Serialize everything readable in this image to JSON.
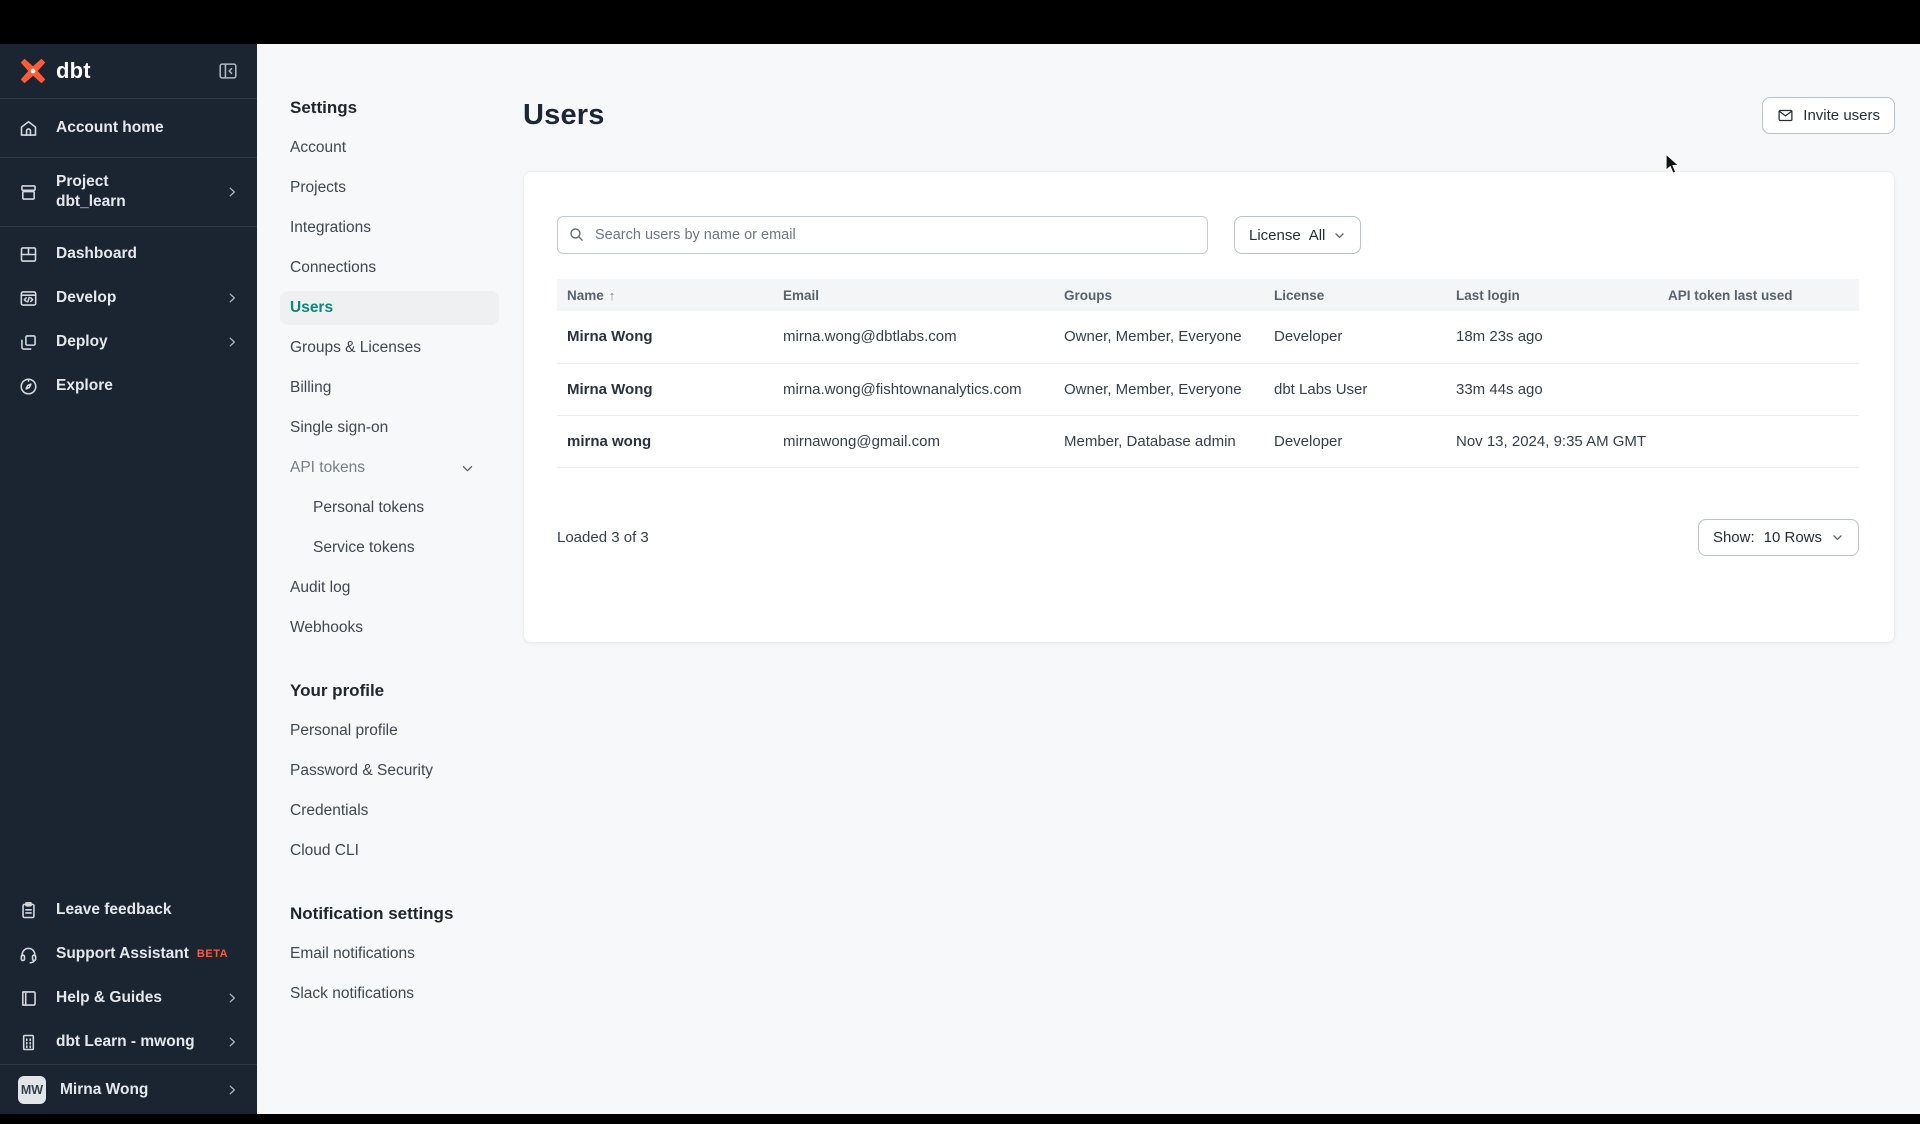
{
  "sidebar": {
    "logo_text": "dbt",
    "items": {
      "account_home": "Account home",
      "project_label": "Project",
      "project_name": "dbt_learn",
      "dashboard": "Dashboard",
      "develop": "Develop",
      "deploy": "Deploy",
      "explore": "Explore",
      "leave_feedback": "Leave feedback",
      "support_assistant": "Support Assistant",
      "support_badge": "BETA",
      "help_guides": "Help & Guides",
      "learn": "dbt Learn - mwong",
      "user_name": "Mirna Wong",
      "user_initials": "MW"
    }
  },
  "settings_nav": {
    "sections": [
      {
        "heading": "Settings",
        "items": [
          {
            "label": "Account"
          },
          {
            "label": "Projects"
          },
          {
            "label": "Integrations"
          },
          {
            "label": "Connections"
          },
          {
            "label": "Users"
          },
          {
            "label": "Groups & Licenses"
          },
          {
            "label": "Billing"
          },
          {
            "label": "Single sign-on"
          },
          {
            "label": "API tokens"
          },
          {
            "label": "Personal tokens"
          },
          {
            "label": "Service tokens"
          },
          {
            "label": "Audit log"
          },
          {
            "label": "Webhooks"
          }
        ]
      },
      {
        "heading": "Your profile",
        "items": [
          {
            "label": "Personal profile"
          },
          {
            "label": "Password & Security"
          },
          {
            "label": "Credentials"
          },
          {
            "label": "Cloud CLI"
          }
        ]
      },
      {
        "heading": "Notification settings",
        "items": [
          {
            "label": "Email notifications"
          },
          {
            "label": "Slack notifications"
          }
        ]
      }
    ]
  },
  "main": {
    "title": "Users",
    "invite_button": "Invite users",
    "search_placeholder": "Search users by name or email",
    "license_filter": {
      "label": "License",
      "value": "All"
    },
    "table": {
      "columns": [
        "Name",
        "Email",
        "Groups",
        "License",
        "Last login",
        "API token last used"
      ],
      "sort_indicator": "↑",
      "rows": [
        {
          "name": "Mirna Wong",
          "email": "mirna.wong@dbtlabs.com",
          "groups": "Owner, Member, Everyone",
          "license": "Developer",
          "last_login": "18m 23s ago",
          "api_token_last_used": ""
        },
        {
          "name": "Mirna Wong",
          "email": "mirna.wong@fishtownanalytics.com",
          "groups": "Owner, Member, Everyone",
          "license": "dbt Labs User",
          "last_login": "33m 44s ago",
          "api_token_last_used": ""
        },
        {
          "name": "mirna wong",
          "email": "mirnawong@gmail.com",
          "groups": "Member, Database admin",
          "license": "Developer",
          "last_login": "Nov 13, 2024, 9:35 AM GMT",
          "api_token_last_used": ""
        }
      ]
    },
    "footer": {
      "loaded": "Loaded 3 of 3",
      "show_label": "Show:",
      "show_value": "10 Rows"
    }
  },
  "colors": {
    "brand_orange": "#ff5c35",
    "sidebar_bg": "#1b2431",
    "active_teal": "#0f867c",
    "page_bg": "#f7f8f9"
  }
}
